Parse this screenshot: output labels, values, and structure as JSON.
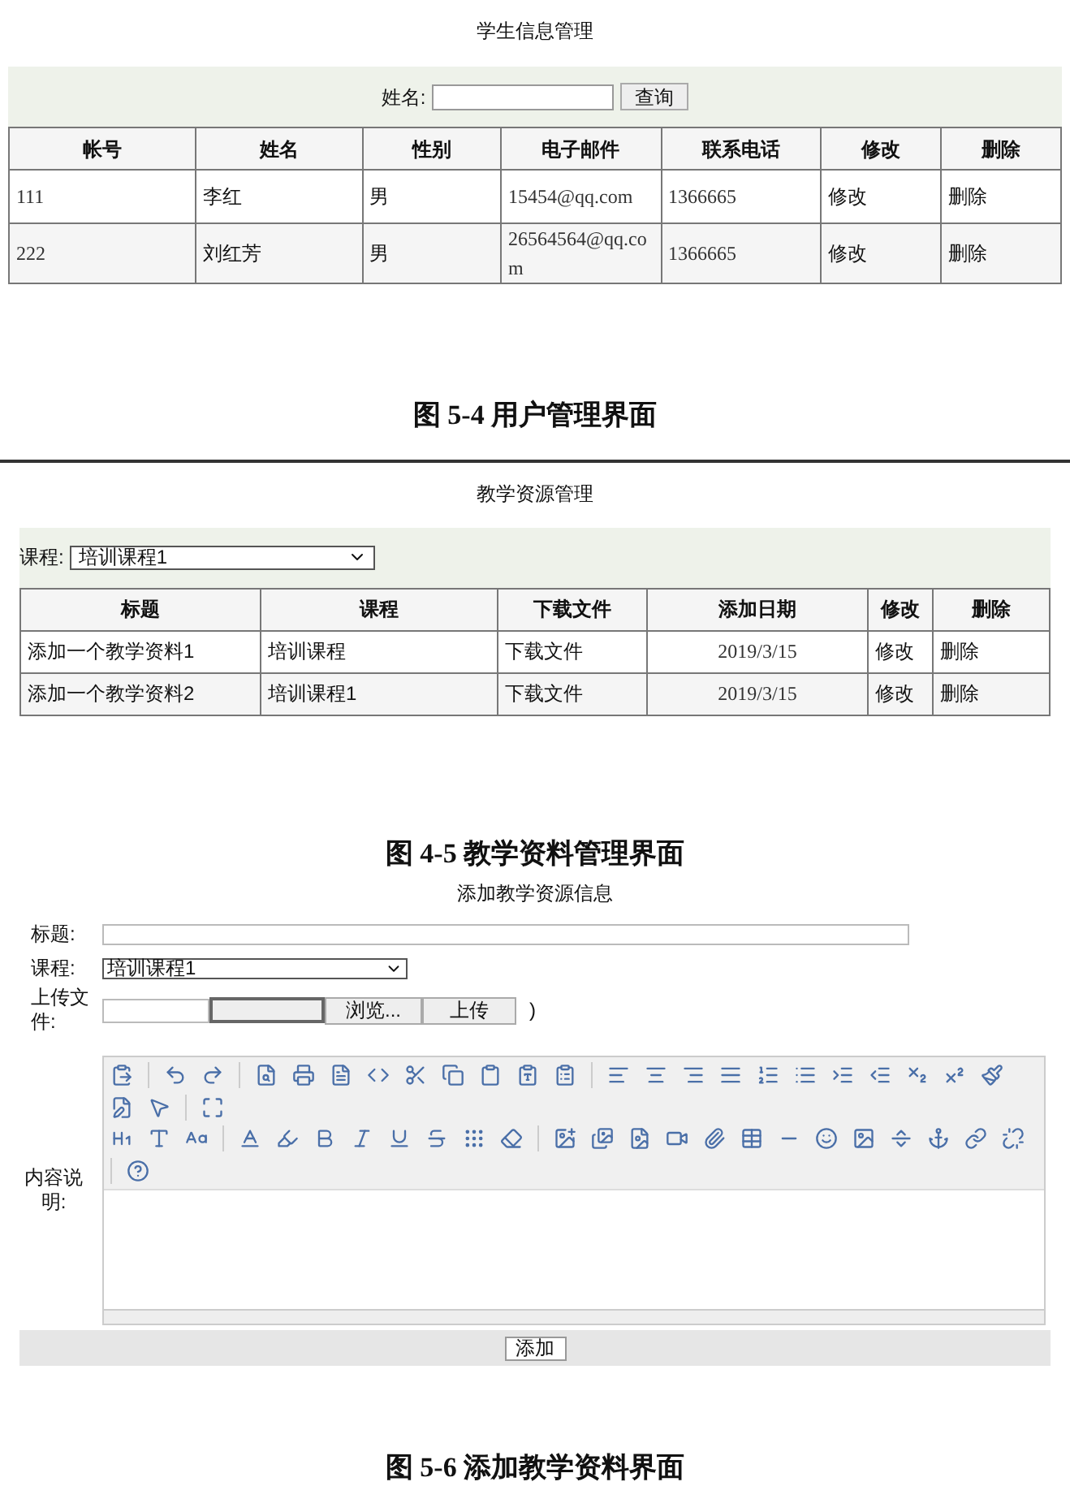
{
  "user_management": {
    "title": "学生信息管理",
    "search": {
      "label": "姓名:",
      "button": "查询"
    },
    "table": {
      "columns": [
        "帐号",
        "姓名",
        "性别",
        "电子邮件",
        "联系电话",
        "修改",
        "删除"
      ],
      "rows": [
        [
          "111",
          "李红",
          "男",
          "15454@qq.com",
          "1366665",
          "修改",
          "删除"
        ],
        [
          "222",
          "刘红芳",
          "男",
          "26564564@qq.com",
          "1366665",
          "修改",
          "删除"
        ]
      ]
    }
  },
  "caption_1": "图 5-4 用户管理界面",
  "resource_management": {
    "title": "教学资源管理",
    "filter": {
      "label": "课程:",
      "value": "培训课程1"
    },
    "table": {
      "columns": [
        "标题",
        "课程",
        "下载文件",
        "添加日期",
        "修改",
        "删除"
      ],
      "rows": [
        [
          "添加一个教学资料1",
          "培训课程",
          "下载文件",
          "2019/3/15",
          "修改",
          "删除"
        ],
        [
          "添加一个教学资料2",
          "培训课程1",
          "下载文件",
          "2019/3/15",
          "修改",
          "删除"
        ]
      ]
    }
  },
  "caption_2": "图 4-5 教学资料管理界面",
  "add_resource": {
    "title": "添加教学资源信息",
    "title_label": "标题:",
    "course_label": "课程:",
    "course_value": "培训课程1",
    "upload_label": "上传文件:",
    "browse_button": "浏览...",
    "upload_button": "上传",
    "upload_suffix": ")",
    "content_label": "内容说明:",
    "submit_button": "添加"
  },
  "caption_3": "图 5-6 添加教学资料界面"
}
